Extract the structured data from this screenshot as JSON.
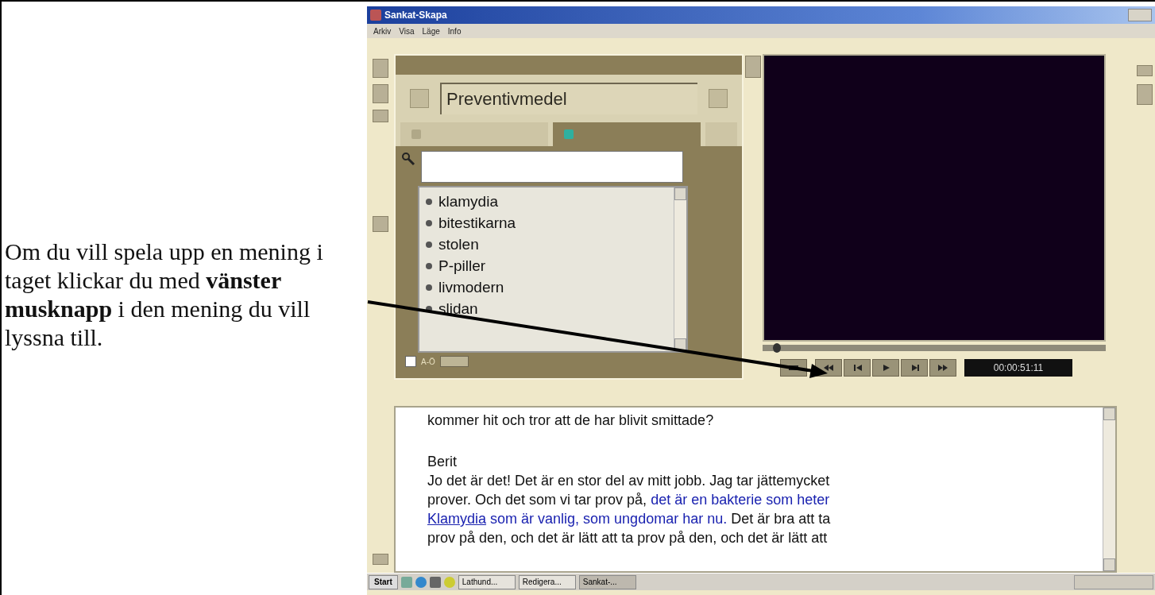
{
  "instruction": {
    "text": "Om du vill spela upp en mening i taget klickar du med **vänster musknapp** i den mening du vill lyssna till."
  },
  "window": {
    "title": "Sankat-Skapa"
  },
  "menu": [
    "Arkiv",
    "Visa",
    "Läge",
    "Info"
  ],
  "topic_field": {
    "value": "Preventivmedel"
  },
  "tabs": [
    {
      "selected": false
    },
    {
      "selected": true
    }
  ],
  "word_list": {
    "items": [
      "klamydia",
      "bitestikarna",
      "stolen",
      "P-piller",
      "livmodern",
      "slidan"
    ],
    "sort_checkbox": {
      "label": "A-Ö",
      "checked": false
    }
  },
  "player": {
    "position": {
      "level": 0.03
    },
    "timecode": "00:00:51:11"
  },
  "transcript": {
    "lines": [
      {
        "kind": "speech",
        "segments": [
          {
            "text": "kommer hit och tror att de har blivit smittade?",
            "highlighted": false,
            "link": false
          }
        ]
      },
      {
        "kind": "speaker",
        "segments": [
          {
            "text": "Berit",
            "highlighted": false,
            "link": false
          }
        ]
      },
      {
        "kind": "speech",
        "segments": [
          {
            "text": "Jo det är det! Det är en stor del av mitt jobb. Jag tar jättemycket",
            "highlighted": false,
            "link": false
          }
        ]
      },
      {
        "kind": "speech",
        "segments": [
          {
            "text": "prover. Och det som vi tar prov på,",
            "highlighted": false,
            "link": false
          },
          {
            "text": "det är en bakterie som heter",
            "highlighted": true,
            "link": false
          }
        ]
      },
      {
        "kind": "speech",
        "segments": [
          {
            "text": "Klamydia",
            "highlighted": true,
            "link": true
          },
          {
            "text": "som är vanlig, som ungdomar har nu.",
            "highlighted": true,
            "link": false
          },
          {
            "text": "Det är bra att ta",
            "highlighted": false,
            "link": false
          }
        ]
      },
      {
        "kind": "speech",
        "segments": [
          {
            "text": "prov på den, och det är lätt att ta prov på den, och det är lätt att",
            "highlighted": false,
            "link": false
          }
        ]
      }
    ]
  },
  "taskbar": {
    "start": "Start",
    "tasks": [
      {
        "label": "Lathund...",
        "selected": false
      },
      {
        "label": "Redigera...",
        "selected": false
      },
      {
        "label": "Sankat-...",
        "selected": true
      }
    ]
  }
}
